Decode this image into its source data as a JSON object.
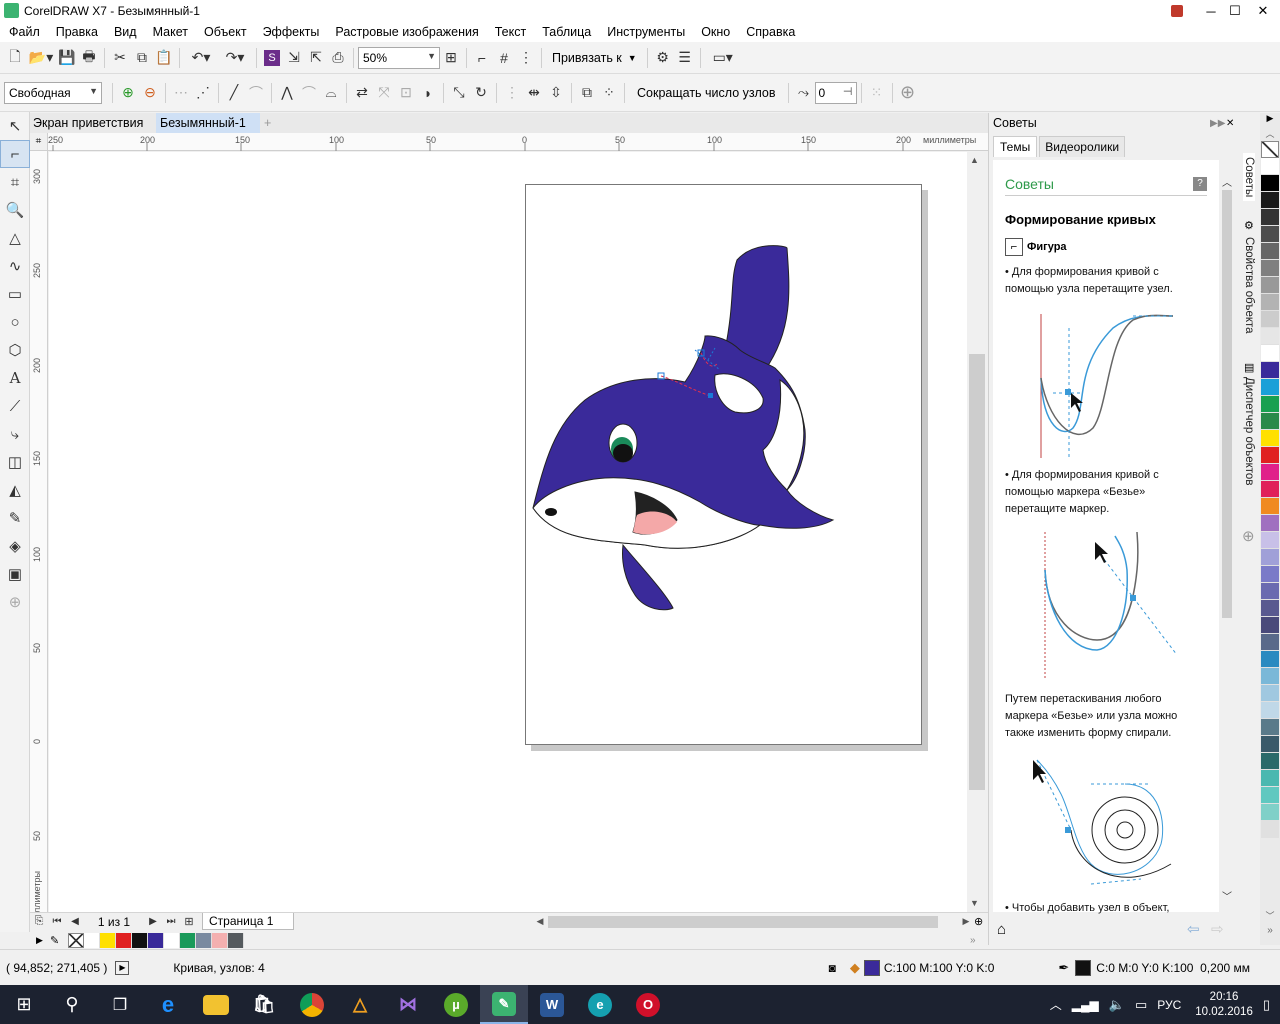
{
  "window": {
    "title": "CorelDRAW X7 - Безымянный-1",
    "minimize": "─",
    "maximize": "☐",
    "close": "✕"
  },
  "menu": [
    "Файл",
    "Правка",
    "Вид",
    "Макет",
    "Объект",
    "Эффекты",
    "Растровые изображения",
    "Текст",
    "Таблица",
    "Инструменты",
    "Окно",
    "Справка"
  ],
  "toolbar": {
    "zoom": "50%",
    "snap_label": "Привязать к"
  },
  "propbar": {
    "mode": "Свободная",
    "reduce_nodes": "Сокращать число узлов",
    "smoothness": "0"
  },
  "doc_tabs": [
    {
      "label": "Экран приветствия"
    },
    {
      "label": "Безымянный-1"
    }
  ],
  "ruler": {
    "unit": "миллиметры",
    "h_labels": [
      "250",
      "200",
      "150",
      "100",
      "50",
      "0",
      "50",
      "100",
      "150",
      "200"
    ],
    "v_labels": [
      "300",
      "250",
      "200",
      "150",
      "100",
      "50",
      "0",
      "50"
    ]
  },
  "page_nav": {
    "counter": "1 из 1",
    "page_tab": "Страница 1"
  },
  "docker": {
    "header": "Советы",
    "tabs": [
      "Темы",
      "Видеоролики"
    ],
    "section": "Советы",
    "heading": "Формирование кривых",
    "tool_name": "Фигура",
    "tip1": "Для формирования кривой с помощью узла перетащите узел.",
    "tip2": "Для формирования кривой с помощью маркера «Безье» перетащите маркер.",
    "tip3": "Путем перетаскивания любого маркера «Безье» или узла можно также изменить форму спирали.",
    "tip4": "Чтобы добавить узел в объект,",
    "vtabs": [
      "Советы",
      "Свойства объекта",
      "Диспетчер объектов"
    ]
  },
  "status": {
    "coords": "( 94,852; 271,405 )",
    "object_info": "Кривая, узлов: 4",
    "fill": "C:100 M:100 Y:0 K:0",
    "outline": "C:0 M:0 Y:0 K:100  0,200 мм",
    "fill_color": "#3a2a9a",
    "outline_color": "#111111"
  },
  "doc_palette": [
    "#ffffff",
    "#ffe000",
    "#e02020",
    "#111111",
    "#3a2a9a",
    "#ffffff",
    "#1a9a5a",
    "#7a8aa0",
    "#f4b0b0",
    "#555a5e"
  ],
  "palette": [
    "#ffffff",
    "#000000",
    "#1a1a1a",
    "#333333",
    "#4d4d4d",
    "#666666",
    "#808080",
    "#999999",
    "#b3b3b3",
    "#cccccc",
    "#e6e6e6",
    "#ffffff",
    "#3a2a9a",
    "#1aa0d8",
    "#19a050",
    "#2a8a4a",
    "#ffe000",
    "#e02020",
    "#e0208a",
    "#e0205a",
    "#f08a20",
    "#a070c0",
    "#c8c0e8",
    "#a0a0d8",
    "#7a7ac8",
    "#6a6ab0",
    "#5a5a90",
    "#4a4a7a",
    "#5a6a8a",
    "#2a8ac0",
    "#7ab8d8",
    "#a0c8e0",
    "#c0d8e8",
    "#5a7a8a",
    "#3a5a6a",
    "#2a6a6a",
    "#4ab8b0",
    "#60c8c0",
    "#80d0c8",
    "#e0e0e0"
  ],
  "taskbar": {
    "time": "20:16",
    "date": "10.02.2016",
    "lang": "РУС"
  }
}
